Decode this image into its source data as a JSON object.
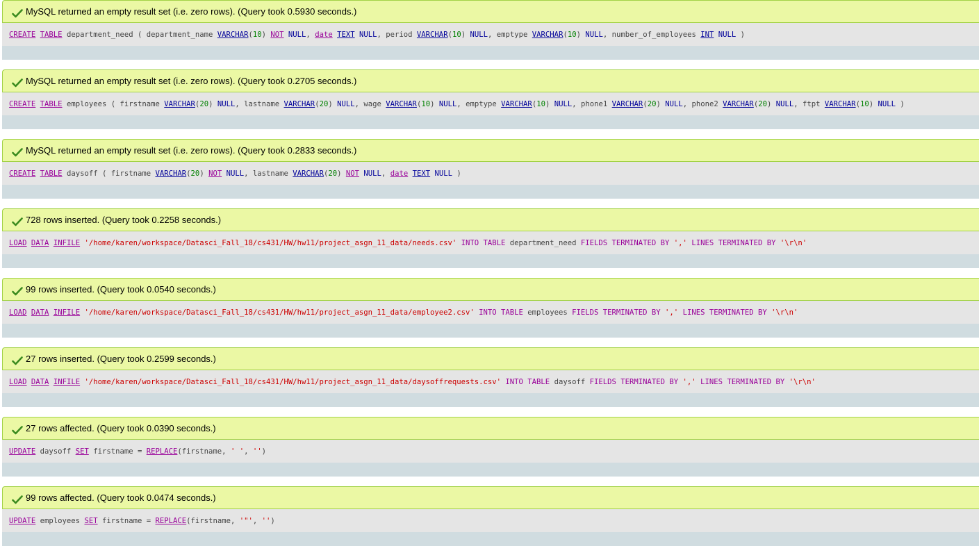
{
  "results": [
    {
      "message": "MySQL returned an empty result set (i.e. zero rows). (Query took 0.5930 seconds.)",
      "sql": [
        {
          "t": "CREATE",
          "c": "kw"
        },
        {
          "t": " ",
          "c": "pn"
        },
        {
          "t": "TABLE",
          "c": "kw"
        },
        {
          "t": " department_need ( department_name ",
          "c": "id"
        },
        {
          "t": "VARCHAR",
          "c": "ty"
        },
        {
          "t": "(",
          "c": "pn"
        },
        {
          "t": "10",
          "c": "num"
        },
        {
          "t": ") ",
          "c": "pn"
        },
        {
          "t": "NOT",
          "c": "kw"
        },
        {
          "t": " ",
          "c": "pn"
        },
        {
          "t": "NULL",
          "c": "nu"
        },
        {
          "t": ", ",
          "c": "pn"
        },
        {
          "t": "date",
          "c": "kw"
        },
        {
          "t": " ",
          "c": "pn"
        },
        {
          "t": "TEXT",
          "c": "ty"
        },
        {
          "t": " ",
          "c": "pn"
        },
        {
          "t": "NULL",
          "c": "nu"
        },
        {
          "t": ", period ",
          "c": "id"
        },
        {
          "t": "VARCHAR",
          "c": "ty"
        },
        {
          "t": "(",
          "c": "pn"
        },
        {
          "t": "10",
          "c": "num"
        },
        {
          "t": ") ",
          "c": "pn"
        },
        {
          "t": "NULL",
          "c": "nu"
        },
        {
          "t": ", emptype ",
          "c": "id"
        },
        {
          "t": "VARCHAR",
          "c": "ty"
        },
        {
          "t": "(",
          "c": "pn"
        },
        {
          "t": "10",
          "c": "num"
        },
        {
          "t": ") ",
          "c": "pn"
        },
        {
          "t": "NULL",
          "c": "nu"
        },
        {
          "t": ", number_of_employees ",
          "c": "id"
        },
        {
          "t": "INT",
          "c": "ty"
        },
        {
          "t": " ",
          "c": "pn"
        },
        {
          "t": "NULL",
          "c": "nu"
        },
        {
          "t": " )",
          "c": "pn"
        }
      ]
    },
    {
      "message": "MySQL returned an empty result set (i.e. zero rows). (Query took 0.2705 seconds.)",
      "sql": [
        {
          "t": "CREATE",
          "c": "kw"
        },
        {
          "t": " ",
          "c": "pn"
        },
        {
          "t": "TABLE",
          "c": "kw"
        },
        {
          "t": " employees ( firstname ",
          "c": "id"
        },
        {
          "t": "VARCHAR",
          "c": "ty"
        },
        {
          "t": "(",
          "c": "pn"
        },
        {
          "t": "20",
          "c": "num"
        },
        {
          "t": ") ",
          "c": "pn"
        },
        {
          "t": "NULL",
          "c": "nu"
        },
        {
          "t": ", lastname ",
          "c": "id"
        },
        {
          "t": "VARCHAR",
          "c": "ty"
        },
        {
          "t": "(",
          "c": "pn"
        },
        {
          "t": "20",
          "c": "num"
        },
        {
          "t": ") ",
          "c": "pn"
        },
        {
          "t": "NULL",
          "c": "nu"
        },
        {
          "t": ", wage ",
          "c": "id"
        },
        {
          "t": "VARCHAR",
          "c": "ty"
        },
        {
          "t": "(",
          "c": "pn"
        },
        {
          "t": "10",
          "c": "num"
        },
        {
          "t": ") ",
          "c": "pn"
        },
        {
          "t": "NULL",
          "c": "nu"
        },
        {
          "t": ", emptype ",
          "c": "id"
        },
        {
          "t": "VARCHAR",
          "c": "ty"
        },
        {
          "t": "(",
          "c": "pn"
        },
        {
          "t": "10",
          "c": "num"
        },
        {
          "t": ") ",
          "c": "pn"
        },
        {
          "t": "NULL",
          "c": "nu"
        },
        {
          "t": ", phone1 ",
          "c": "id"
        },
        {
          "t": "VARCHAR",
          "c": "ty"
        },
        {
          "t": "(",
          "c": "pn"
        },
        {
          "t": "20",
          "c": "num"
        },
        {
          "t": ") ",
          "c": "pn"
        },
        {
          "t": "NULL",
          "c": "nu"
        },
        {
          "t": ", phone2 ",
          "c": "id"
        },
        {
          "t": "VARCHAR",
          "c": "ty"
        },
        {
          "t": "(",
          "c": "pn"
        },
        {
          "t": "20",
          "c": "num"
        },
        {
          "t": ") ",
          "c": "pn"
        },
        {
          "t": "NULL",
          "c": "nu"
        },
        {
          "t": ", ftpt ",
          "c": "id"
        },
        {
          "t": "VARCHAR",
          "c": "ty"
        },
        {
          "t": "(",
          "c": "pn"
        },
        {
          "t": "10",
          "c": "num"
        },
        {
          "t": ") ",
          "c": "pn"
        },
        {
          "t": "NULL",
          "c": "nu"
        },
        {
          "t": " )",
          "c": "pn"
        }
      ]
    },
    {
      "message": "MySQL returned an empty result set (i.e. zero rows). (Query took 0.2833 seconds.)",
      "sql": [
        {
          "t": "CREATE",
          "c": "kw"
        },
        {
          "t": " ",
          "c": "pn"
        },
        {
          "t": "TABLE",
          "c": "kw"
        },
        {
          "t": " daysoff ( firstname ",
          "c": "id"
        },
        {
          "t": "VARCHAR",
          "c": "ty"
        },
        {
          "t": "(",
          "c": "pn"
        },
        {
          "t": "20",
          "c": "num"
        },
        {
          "t": ") ",
          "c": "pn"
        },
        {
          "t": "NOT",
          "c": "kw"
        },
        {
          "t": " ",
          "c": "pn"
        },
        {
          "t": "NULL",
          "c": "nu"
        },
        {
          "t": ", lastname ",
          "c": "id"
        },
        {
          "t": "VARCHAR",
          "c": "ty"
        },
        {
          "t": "(",
          "c": "pn"
        },
        {
          "t": "20",
          "c": "num"
        },
        {
          "t": ") ",
          "c": "pn"
        },
        {
          "t": "NOT",
          "c": "kw"
        },
        {
          "t": " ",
          "c": "pn"
        },
        {
          "t": "NULL",
          "c": "nu"
        },
        {
          "t": ", ",
          "c": "pn"
        },
        {
          "t": "date",
          "c": "kw"
        },
        {
          "t": " ",
          "c": "pn"
        },
        {
          "t": "TEXT",
          "c": "ty"
        },
        {
          "t": " ",
          "c": "pn"
        },
        {
          "t": "NULL",
          "c": "nu"
        },
        {
          "t": " )",
          "c": "pn"
        }
      ]
    },
    {
      "message": "728 rows inserted. (Query took 0.2258 seconds.)",
      "sql": [
        {
          "t": "LOAD",
          "c": "kw"
        },
        {
          "t": " ",
          "c": "pn"
        },
        {
          "t": "DATA",
          "c": "kw"
        },
        {
          "t": " ",
          "c": "pn"
        },
        {
          "t": "INFILE",
          "c": "kw"
        },
        {
          "t": " ",
          "c": "pn"
        },
        {
          "t": "'/home/karen/workspace/Datasci_Fall_18/cs431/HW/hw11/project_asgn_11_data/needs.csv'",
          "c": "str"
        },
        {
          "t": " ",
          "c": "pn"
        },
        {
          "t": "INTO TABLE",
          "c": "kw2"
        },
        {
          "t": " department_need ",
          "c": "id"
        },
        {
          "t": "FIELDS TERMINATED BY",
          "c": "kw2"
        },
        {
          "t": " ",
          "c": "pn"
        },
        {
          "t": "','",
          "c": "str"
        },
        {
          "t": " ",
          "c": "pn"
        },
        {
          "t": "LINES TERMINATED BY",
          "c": "kw2"
        },
        {
          "t": " ",
          "c": "pn"
        },
        {
          "t": "'\\r\\n'",
          "c": "str"
        }
      ]
    },
    {
      "message": "99 rows inserted. (Query took 0.0540 seconds.)",
      "sql": [
        {
          "t": "LOAD",
          "c": "kw"
        },
        {
          "t": " ",
          "c": "pn"
        },
        {
          "t": "DATA",
          "c": "kw"
        },
        {
          "t": " ",
          "c": "pn"
        },
        {
          "t": "INFILE",
          "c": "kw"
        },
        {
          "t": " ",
          "c": "pn"
        },
        {
          "t": "'/home/karen/workspace/Datasci_Fall_18/cs431/HW/hw11/project_asgn_11_data/employee2.csv'",
          "c": "str"
        },
        {
          "t": " ",
          "c": "pn"
        },
        {
          "t": "INTO TABLE",
          "c": "kw2"
        },
        {
          "t": " employees ",
          "c": "id"
        },
        {
          "t": "FIELDS TERMINATED BY",
          "c": "kw2"
        },
        {
          "t": " ",
          "c": "pn"
        },
        {
          "t": "','",
          "c": "str"
        },
        {
          "t": " ",
          "c": "pn"
        },
        {
          "t": "LINES TERMINATED BY",
          "c": "kw2"
        },
        {
          "t": " ",
          "c": "pn"
        },
        {
          "t": "'\\r\\n'",
          "c": "str"
        }
      ]
    },
    {
      "message": "27 rows inserted. (Query took 0.2599 seconds.)",
      "sql": [
        {
          "t": "LOAD",
          "c": "kw"
        },
        {
          "t": " ",
          "c": "pn"
        },
        {
          "t": "DATA",
          "c": "kw"
        },
        {
          "t": " ",
          "c": "pn"
        },
        {
          "t": "INFILE",
          "c": "kw"
        },
        {
          "t": " ",
          "c": "pn"
        },
        {
          "t": "'/home/karen/workspace/Datasci_Fall_18/cs431/HW/hw11/project_asgn_11_data/daysoffrequests.csv'",
          "c": "str"
        },
        {
          "t": " ",
          "c": "pn"
        },
        {
          "t": "INTO TABLE",
          "c": "kw2"
        },
        {
          "t": " daysoff ",
          "c": "id"
        },
        {
          "t": "FIELDS TERMINATED BY",
          "c": "kw2"
        },
        {
          "t": " ",
          "c": "pn"
        },
        {
          "t": "','",
          "c": "str"
        },
        {
          "t": " ",
          "c": "pn"
        },
        {
          "t": "LINES TERMINATED BY",
          "c": "kw2"
        },
        {
          "t": " ",
          "c": "pn"
        },
        {
          "t": "'\\r\\n'",
          "c": "str"
        }
      ]
    },
    {
      "message": "27 rows affected. (Query took 0.0390 seconds.)",
      "sql": [
        {
          "t": "UPDATE",
          "c": "kw"
        },
        {
          "t": " daysoff ",
          "c": "id"
        },
        {
          "t": "SET",
          "c": "kw"
        },
        {
          "t": " firstname = ",
          "c": "id"
        },
        {
          "t": "REPLACE",
          "c": "kw"
        },
        {
          "t": "(firstname, ",
          "c": "pn"
        },
        {
          "t": "' '",
          "c": "str"
        },
        {
          "t": ", ",
          "c": "pn"
        },
        {
          "t": "''",
          "c": "str"
        },
        {
          "t": ")",
          "c": "pn"
        }
      ]
    },
    {
      "message": "99 rows affected. (Query took 0.0474 seconds.)",
      "sql": [
        {
          "t": "UPDATE",
          "c": "kw"
        },
        {
          "t": " employees ",
          "c": "id"
        },
        {
          "t": "SET",
          "c": "kw"
        },
        {
          "t": " firstname = ",
          "c": "id"
        },
        {
          "t": "REPLACE",
          "c": "kw"
        },
        {
          "t": "(firstname, ",
          "c": "pn"
        },
        {
          "t": "'\"'",
          "c": "str"
        },
        {
          "t": ", ",
          "c": "pn"
        },
        {
          "t": "''",
          "c": "str"
        },
        {
          "t": ")",
          "c": "pn"
        }
      ]
    }
  ]
}
